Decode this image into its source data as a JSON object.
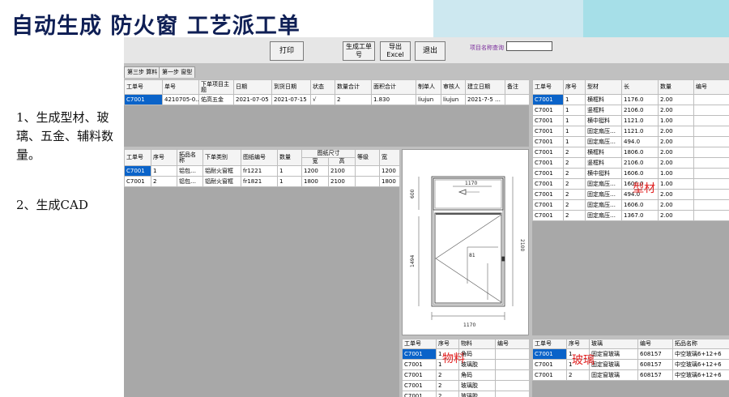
{
  "slide": {
    "title": "自动生成 防火窗 工艺派工单",
    "note1": "1、生成型材、玻璃、五金、辅料数量。",
    "note2": "2、生成CAD"
  },
  "toolbar": {
    "print": "打印",
    "generate": "生成工单号",
    "export": "导出Excel",
    "exit": "退出",
    "query_label": "项目名称查询",
    "query_value": ""
  },
  "tabs": [
    "第三步 算料",
    "第一步 窗型"
  ],
  "order_table": {
    "headers": [
      "工单号",
      "单号",
      "下单项目主题",
      "日期",
      "到货日期",
      "状态",
      "数量合计",
      "面积合计",
      "制单人",
      "审核人",
      "建立日期",
      "备注"
    ],
    "rows": [
      [
        "C7001",
        "4210705-0…",
        "佑高五金",
        "2021-07-05",
        "2021-07-15",
        "√",
        "2",
        "1.830",
        "liujun",
        "liujun",
        "2021-7-5 …",
        ""
      ]
    ]
  },
  "window_table": {
    "headers": [
      "工单号",
      "序号",
      "拓品名称",
      "下单类别",
      "图纸编号",
      "数量",
      "宽",
      "高",
      "等级"
    ],
    "group_header": "图纸尺寸",
    "rows": [
      [
        "C7001",
        "1",
        "铝包…",
        "铝耐火窗框",
        "fr1221",
        "1",
        "1200",
        "2100",
        ""
      ],
      [
        "C7001",
        "2",
        "铝包…",
        "铝耐火窗框",
        "fr1821",
        "1",
        "1800",
        "2100",
        ""
      ]
    ],
    "extra_col": [
      "1200",
      "1800"
    ],
    "extra_header": "宽"
  },
  "profile_table": {
    "headers": [
      "工单号",
      "序号",
      "型材",
      "长",
      "数量",
      "编号"
    ],
    "rows": [
      [
        "C7001",
        "1",
        "横框料",
        "1176.0",
        "2.00",
        ""
      ],
      [
        "C7001",
        "1",
        "竖框料",
        "2106.0",
        "2.00",
        ""
      ],
      [
        "C7001",
        "1",
        "横中挺料",
        "1121.0",
        "1.00",
        ""
      ],
      [
        "C7001",
        "1",
        "固定扇压…",
        "1121.0",
        "2.00",
        ""
      ],
      [
        "C7001",
        "1",
        "固定扇压…",
        "494.0",
        "2.00",
        ""
      ],
      [
        "C7001",
        "2",
        "横框料",
        "1806.0",
        "2.00",
        ""
      ],
      [
        "C7001",
        "2",
        "竖框料",
        "2106.0",
        "2.00",
        ""
      ],
      [
        "C7001",
        "2",
        "横中挺料",
        "1606.0",
        "1.00",
        ""
      ],
      [
        "C7001",
        "2",
        "固定扇压…",
        "1606.0",
        "1.00",
        ""
      ],
      [
        "C7001",
        "2",
        "固定扇压…",
        "494.0",
        "2.00",
        ""
      ],
      [
        "C7001",
        "2",
        "固定扇压…",
        "1606.0",
        "2.00",
        ""
      ],
      [
        "C7001",
        "2",
        "固定扇压…",
        "1367.0",
        "2.00",
        ""
      ]
    ]
  },
  "material_table": {
    "headers": [
      "工单号",
      "序号",
      "物料",
      "编号"
    ],
    "rows": [
      [
        "C7001",
        "1",
        "角码",
        ""
      ],
      [
        "C7001",
        "1",
        "玻璃胶",
        ""
      ],
      [
        "C7001",
        "2",
        "角码",
        ""
      ],
      [
        "C7001",
        "2",
        "玻璃胶",
        ""
      ],
      [
        "C7001",
        "2",
        "玻璃胶",
        ""
      ]
    ]
  },
  "glass_table": {
    "headers": [
      "工单号",
      "序号",
      "玻璃",
      "编号",
      "拓品名称"
    ],
    "rows": [
      [
        "C7001",
        "1",
        "固定窗玻璃",
        "608157",
        "中空玻璃6+12+6"
      ],
      [
        "C7001",
        "1",
        "固定窗玻璃",
        "608157",
        "中空玻璃6+12+6"
      ],
      [
        "C7001",
        "2",
        "固定窗玻璃",
        "608157",
        "中空玻璃6+12+6"
      ]
    ]
  },
  "cad": {
    "width": "1170",
    "height": "2100",
    "top_height": "600",
    "inner_width": "1170",
    "side": "1494",
    "corner": "81"
  },
  "annotations": {
    "profile": "型材",
    "material": "物料",
    "glass": "玻璃"
  },
  "colors": {
    "title": "#0f1f55",
    "selection": "#0a63c9",
    "annotation": "#e02020",
    "panel_gray": "#a8a8a8"
  }
}
